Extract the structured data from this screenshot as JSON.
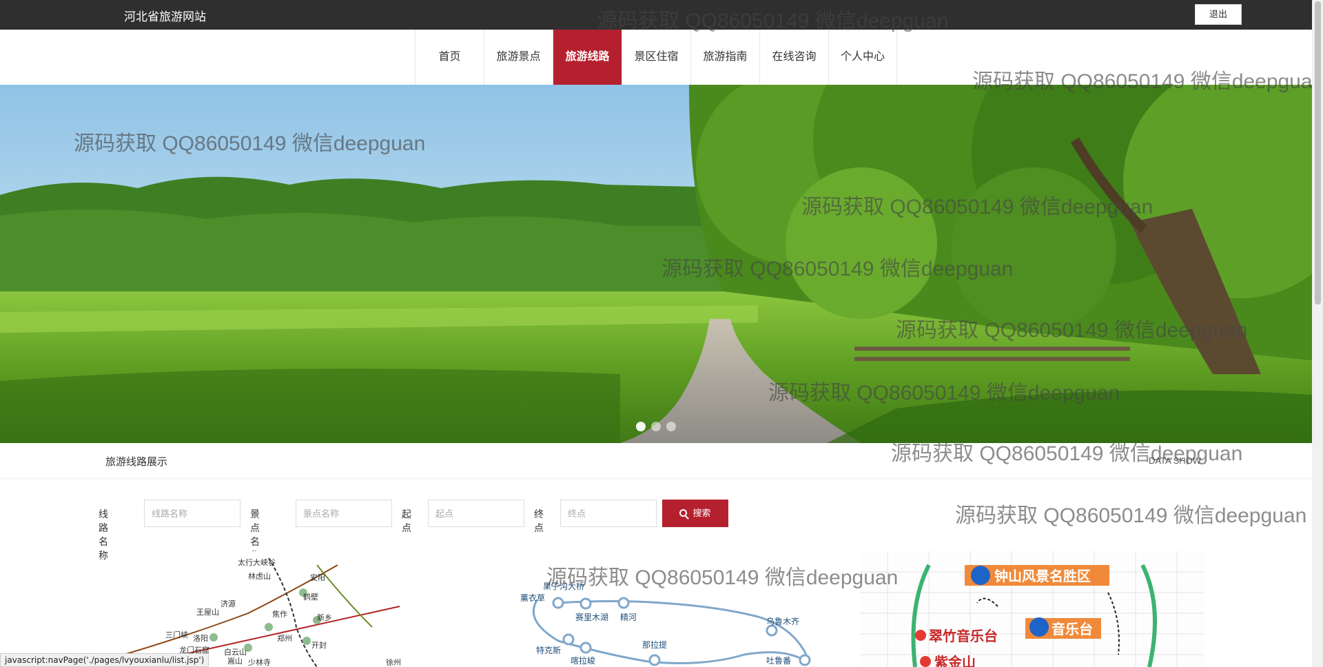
{
  "header": {
    "site_title": "河北省旅游网站",
    "logout_label": "退出"
  },
  "nav": {
    "items": [
      {
        "label": "首页",
        "active": false
      },
      {
        "label": "旅游景点",
        "active": false
      },
      {
        "label": "旅游线路",
        "active": true
      },
      {
        "label": "景区住宿",
        "active": false
      },
      {
        "label": "旅游指南",
        "active": false
      },
      {
        "label": "在线咨询",
        "active": false
      },
      {
        "label": "个人中心",
        "active": false
      }
    ]
  },
  "banner": {
    "slides": 3,
    "active_slide": 1
  },
  "section": {
    "title": "旅游线路展示",
    "subtitle": "DATA SHOW"
  },
  "search": {
    "route_name_label": "线路名称",
    "route_name_placeholder": "线路名称",
    "spot_name_label": "景点名称",
    "spot_name_placeholder": "景点名称",
    "start_label": "起点",
    "start_placeholder": "起点",
    "end_label": "终点",
    "end_placeholder": "终点",
    "button_label": "搜索"
  },
  "cards": {
    "card1_labels": [
      "太行大峡谷",
      "林虑山",
      "安阳",
      "王屋山",
      "济源",
      "鹤壁",
      "焦作",
      "新乡",
      "三门峡",
      "洛阳",
      "郑州",
      "开封",
      "龙门石窟",
      "白云山",
      "少林寺",
      "嵩山",
      "徐州"
    ],
    "card2_labels": [
      "果子沟大桥",
      "薰衣草",
      "赛里木湖",
      "精河",
      "乌鲁木齐",
      "特克斯",
      "那拉提",
      "喀拉峻",
      "吐鲁番"
    ],
    "card3_labels": [
      "钟山风景名胜区",
      "音乐台",
      "翠竹音乐台",
      "紫金山"
    ]
  },
  "watermark_text": "源码获取 QQ86050149 微信deepguan",
  "status_bar": "javascript:navPage('./pages/lvyouxianlu/list.jsp')",
  "colors": {
    "brand_red": "#b5202e",
    "topbar": "#2f2f2f"
  }
}
